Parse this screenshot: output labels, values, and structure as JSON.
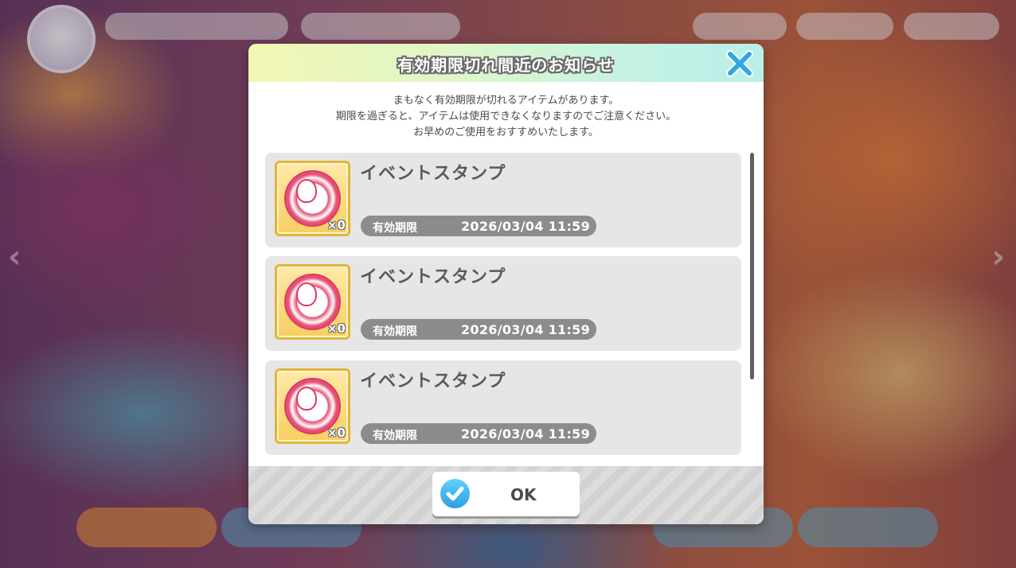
{
  "dialog": {
    "title": "有効期限切れ間近のお知らせ",
    "notice_lines": [
      "まもなく有効期限が切れるアイテムがあります。",
      "期限を過ぎると、アイテムは使用できなくなりますのでご注意ください。",
      "お早めのご使用をおすすめいたします。"
    ],
    "items": [
      {
        "name": "イベントスタンプ",
        "count": "×0",
        "expiry_label": "有効期限",
        "expiry_date": "2026/03/04 11:59"
      },
      {
        "name": "イベントスタンプ",
        "count": "×0",
        "expiry_label": "有効期限",
        "expiry_date": "2026/03/04 11:59"
      },
      {
        "name": "イベントスタンプ",
        "count": "×0",
        "expiry_label": "有効期限",
        "expiry_date": "2026/03/04 11:59"
      }
    ],
    "ok_label": "OK",
    "icons": {
      "close": "close-icon",
      "ok": "check-circle-icon",
      "item": "event-stamp-icon"
    }
  },
  "colors": {
    "header_gradient_start": "#f2f7b4",
    "header_gradient_end": "#b8efe8",
    "close_accent": "#2fa8e6",
    "ok_accent": "#2f9ee0",
    "item_bg": "#e6e6e6",
    "expiry_pill": "#8c8c8c"
  }
}
